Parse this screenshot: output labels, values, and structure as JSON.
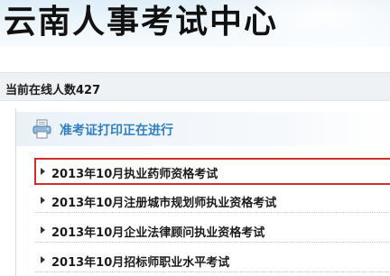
{
  "header": {
    "title": "云南人事考试中心"
  },
  "status": {
    "online_text": "当前在线人数427"
  },
  "notice": {
    "icon": "printer-icon",
    "text": "准考证打印正在进行"
  },
  "exam_list": {
    "items": [
      {
        "label": "2013年10月执业药师资格考试",
        "highlighted": true
      },
      {
        "label": "2013年10月注册城市规划师执业资格考试",
        "highlighted": false
      },
      {
        "label": "2013年10月企业法律顾问执业资格考试",
        "highlighted": false
      },
      {
        "label": "2013年10月招标师职业水平考试",
        "highlighted": false
      }
    ]
  },
  "colors": {
    "notice_text": "#2f7fc1",
    "highlight_border": "#d42a2a",
    "banner_bg": "#dfeef8"
  }
}
